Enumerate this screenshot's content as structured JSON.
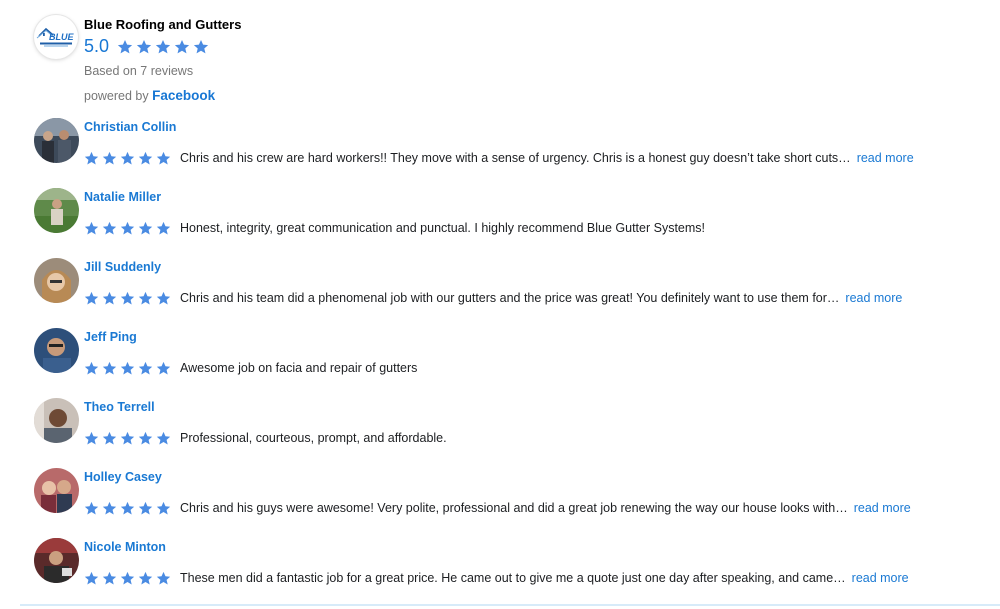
{
  "business": {
    "name": "Blue Roofing and Gutters",
    "logo_text": "BLUE",
    "rating": "5.0",
    "rating_stars": 5,
    "based_on": "Based on 7 reviews",
    "powered_prefix": "powered by",
    "powered_brand": "Facebook",
    "star_icon": "star-icon",
    "accent_color": "#1877d4"
  },
  "review_ui": {
    "read_more_label": "read more"
  },
  "reviews": [
    {
      "name": "Christian Collin",
      "stars": 5,
      "text": "Chris and his crew are hard workers!! They move with a sense of urgency. Chris is a honest guy doesn’t take short cuts…",
      "read_more": true
    },
    {
      "name": "Natalie Miller",
      "stars": 5,
      "text": "Honest, integrity, great communication and punctual. I highly recommend Blue Gutter Systems!",
      "read_more": false
    },
    {
      "name": "Jill Suddenly",
      "stars": 5,
      "text": "Chris and his team did a phenomenal job with our gutters and the price was great!  You definitely want to use them for…",
      "read_more": true
    },
    {
      "name": "Jeff Ping",
      "stars": 5,
      "text": "Awesome job on facia and repair of gutters",
      "read_more": false
    },
    {
      "name": "Theo Terrell",
      "stars": 5,
      "text": "Professional, courteous, prompt, and affordable.",
      "read_more": false
    },
    {
      "name": "Holley Casey",
      "stars": 5,
      "text": "Chris and his guys were awesome! Very polite, professional and did a great job renewing the way our house looks with…",
      "read_more": true
    },
    {
      "name": "Nicole Minton",
      "stars": 5,
      "text": "These men did a fantastic job for a great price. He came out to give me a quote just one day after speaking, and came…",
      "read_more": true
    }
  ]
}
